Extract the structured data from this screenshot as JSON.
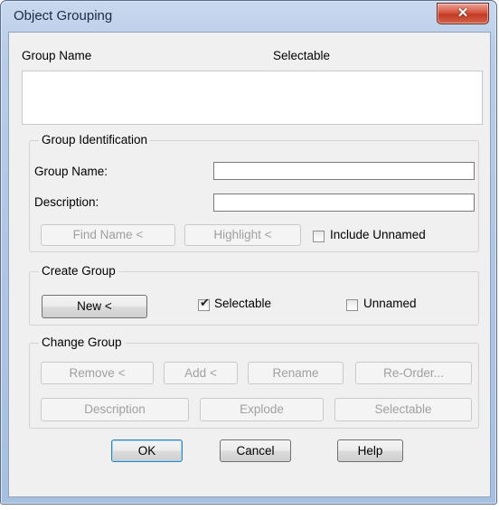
{
  "window": {
    "title": "Object Grouping"
  },
  "group_list": {
    "col_group_name": "Group Name",
    "col_selectable": "Selectable",
    "rows": []
  },
  "group_identification": {
    "legend": "Group Identification",
    "group_name_label": "Group Name:",
    "group_name_value": "",
    "description_label": "Description:",
    "description_value": "",
    "find_name_button": "Find Name <",
    "highlight_button": "Highlight <",
    "include_unnamed_label": "Include Unnamed",
    "include_unnamed_checked": false
  },
  "create_group": {
    "legend": "Create Group",
    "new_button": "New <",
    "selectable_label": "Selectable",
    "selectable_checked": true,
    "unnamed_label": "Unnamed",
    "unnamed_checked": false
  },
  "change_group": {
    "legend": "Change Group",
    "remove_button": "Remove <",
    "add_button": "Add <",
    "rename_button": "Rename",
    "reorder_button": "Re-Order...",
    "description_button": "Description",
    "explode_button": "Explode",
    "selectable_button": "Selectable"
  },
  "footer": {
    "ok_button": "OK",
    "cancel_button": "Cancel",
    "help_button": "Help"
  }
}
